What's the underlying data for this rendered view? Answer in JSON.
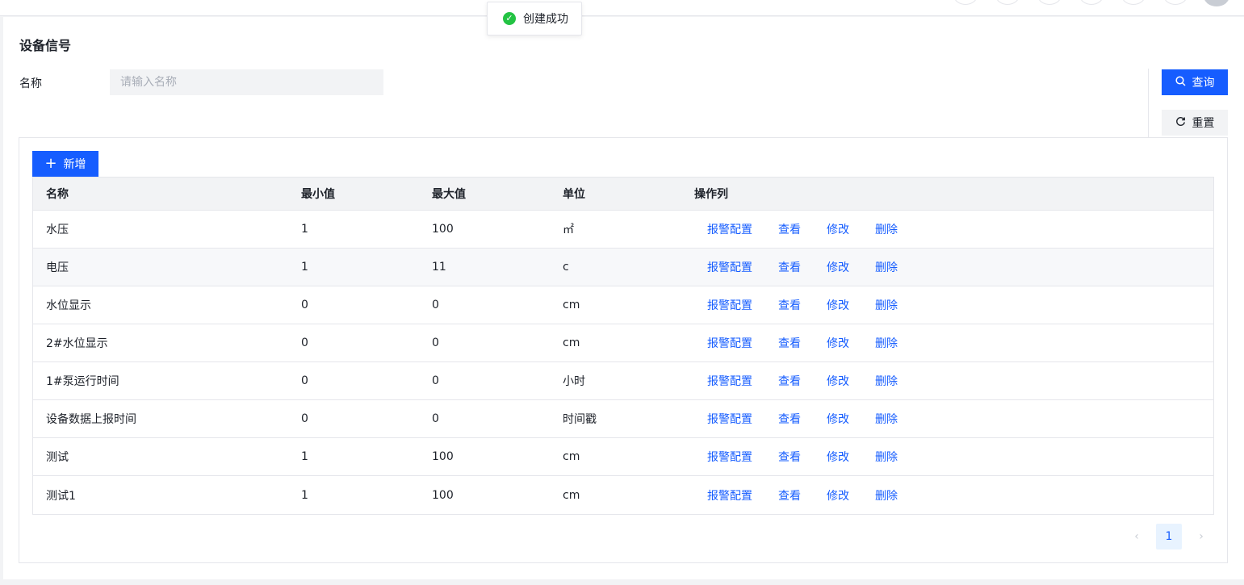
{
  "toast": {
    "text": "创建成功",
    "icon": "check-circle-icon"
  },
  "page": {
    "title": "设备信号"
  },
  "filter": {
    "name_label": "名称",
    "name_placeholder": "请输入名称",
    "search_label": "查询",
    "reset_label": "重置"
  },
  "toolbar": {
    "add_label": "新增"
  },
  "table": {
    "columns": [
      "名称",
      "最小值",
      "最大值",
      "单位",
      "操作列"
    ],
    "actions": [
      "报警配置",
      "查看",
      "修改",
      "删除"
    ],
    "rows": [
      {
        "name": "水压",
        "min": "1",
        "max": "100",
        "unit": "㎡"
      },
      {
        "name": "电压",
        "min": "1",
        "max": "11",
        "unit": "c"
      },
      {
        "name": "水位显示",
        "min": "0",
        "max": "0",
        "unit": "cm"
      },
      {
        "name": "2#水位显示",
        "min": "0",
        "max": "0",
        "unit": "cm"
      },
      {
        "name": "1#泵运行时间",
        "min": "0",
        "max": "0",
        "unit": "小时"
      },
      {
        "name": "设备数据上报时间",
        "min": "0",
        "max": "0",
        "unit": "时间戳"
      },
      {
        "name": "测试",
        "min": "1",
        "max": "100",
        "unit": "cm"
      },
      {
        "name": "测试1",
        "min": "1",
        "max": "100",
        "unit": "cm"
      }
    ]
  },
  "pagination": {
    "current_page": "1"
  },
  "colors": {
    "primary": "#165dff",
    "success": "#23c343"
  }
}
